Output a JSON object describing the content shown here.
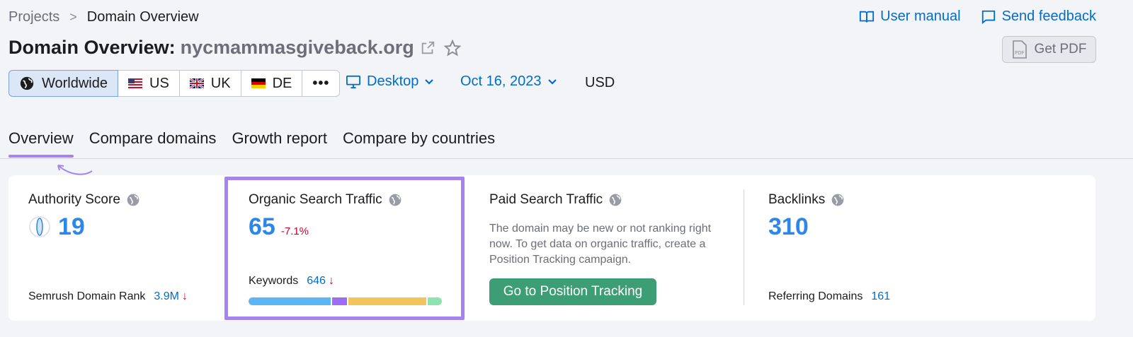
{
  "breadcrumb": {
    "parent": "Projects",
    "separator": ">",
    "current": "Domain Overview"
  },
  "top_links": {
    "manual": "User manual",
    "feedback": "Send feedback"
  },
  "title": {
    "label": "Domain Overview:",
    "domain": "nycmammasgiveback.org"
  },
  "pdf_button": {
    "icon_text": "PDF",
    "label": "Get PDF"
  },
  "regions": [
    {
      "label": "Worldwide"
    },
    {
      "label": "US"
    },
    {
      "label": "UK"
    },
    {
      "label": "DE"
    },
    {
      "label": "•••"
    }
  ],
  "device": "Desktop",
  "date": "Oct 16, 2023",
  "currency": "USD",
  "tabs": [
    "Overview",
    "Compare domains",
    "Growth report",
    "Compare by countries"
  ],
  "metrics": {
    "authority": {
      "title": "Authority Score",
      "value": "19",
      "rank_label": "Semrush Domain Rank",
      "rank_value": "3.9M",
      "rank_arrow": "↓"
    },
    "organic": {
      "title": "Organic Search Traffic",
      "value": "65",
      "delta": "-7.1%",
      "keywords_label": "Keywords",
      "keywords_value": "646",
      "keywords_arrow": "↓"
    },
    "paid": {
      "title": "Paid Search Traffic",
      "description": "The domain may be new or not ranking right now. To get data on organic traffic, create a Position Tracking campaign.",
      "button": "Go to Position Tracking"
    },
    "backlinks": {
      "title": "Backlinks",
      "value": "310",
      "ref_label": "Referring Domains",
      "ref_value": "161"
    }
  },
  "colors": {
    "accent_blue": "#006dca",
    "metric_blue": "#2e87e6",
    "highlight_purple": "#a583f0",
    "button_green": "#3d9e76",
    "negative_red": "#d1002f",
    "keyword_bar": [
      "#5cb6f5",
      "#9d6ef5",
      "#f2c55c",
      "#8ee3b1"
    ]
  }
}
